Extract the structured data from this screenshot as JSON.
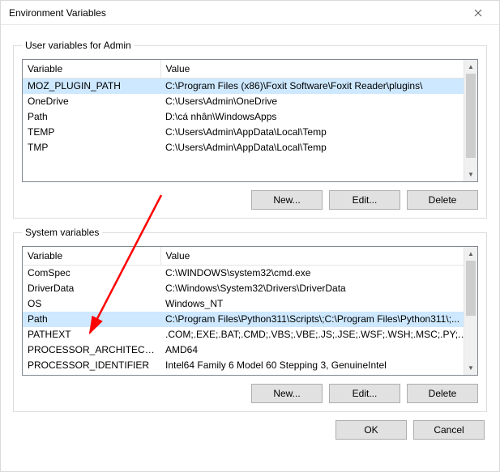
{
  "window": {
    "title": "Environment Variables"
  },
  "user_group": {
    "legend": "User variables for Admin",
    "col_var": "Variable",
    "col_val": "Value",
    "rows": [
      {
        "var": "MOZ_PLUGIN_PATH",
        "val": "C:\\Program Files (x86)\\Foxit Software\\Foxit Reader\\plugins\\"
      },
      {
        "var": "OneDrive",
        "val": "C:\\Users\\Admin\\OneDrive"
      },
      {
        "var": "Path",
        "val": "D:\\cá nhân\\WindowsApps"
      },
      {
        "var": "TEMP",
        "val": "C:\\Users\\Admin\\AppData\\Local\\Temp"
      },
      {
        "var": "TMP",
        "val": "C:\\Users\\Admin\\AppData\\Local\\Temp"
      }
    ],
    "selected_index": 0,
    "buttons": {
      "new": "New...",
      "edit": "Edit...",
      "delete": "Delete"
    }
  },
  "system_group": {
    "legend": "System variables",
    "col_var": "Variable",
    "col_val": "Value",
    "rows": [
      {
        "var": "ComSpec",
        "val": "C:\\WINDOWS\\system32\\cmd.exe"
      },
      {
        "var": "DriverData",
        "val": "C:\\Windows\\System32\\Drivers\\DriverData"
      },
      {
        "var": "OS",
        "val": "Windows_NT"
      },
      {
        "var": "Path",
        "val": "C:\\Program Files\\Python311\\Scripts\\;C:\\Program Files\\Python311\\;..."
      },
      {
        "var": "PATHEXT",
        "val": ".COM;.EXE;.BAT;.CMD;.VBS;.VBE;.JS;.JSE;.WSF;.WSH;.MSC;.PY;.PYW"
      },
      {
        "var": "PROCESSOR_ARCHITECTURE",
        "val": "AMD64"
      },
      {
        "var": "PROCESSOR_IDENTIFIER",
        "val": "Intel64 Family 6 Model 60 Stepping 3, GenuineIntel"
      }
    ],
    "selected_index": 3,
    "buttons": {
      "new": "New...",
      "edit": "Edit...",
      "delete": "Delete"
    }
  },
  "footer": {
    "ok": "OK",
    "cancel": "Cancel"
  },
  "annotation": {
    "arrow_color": "#ff0000"
  }
}
